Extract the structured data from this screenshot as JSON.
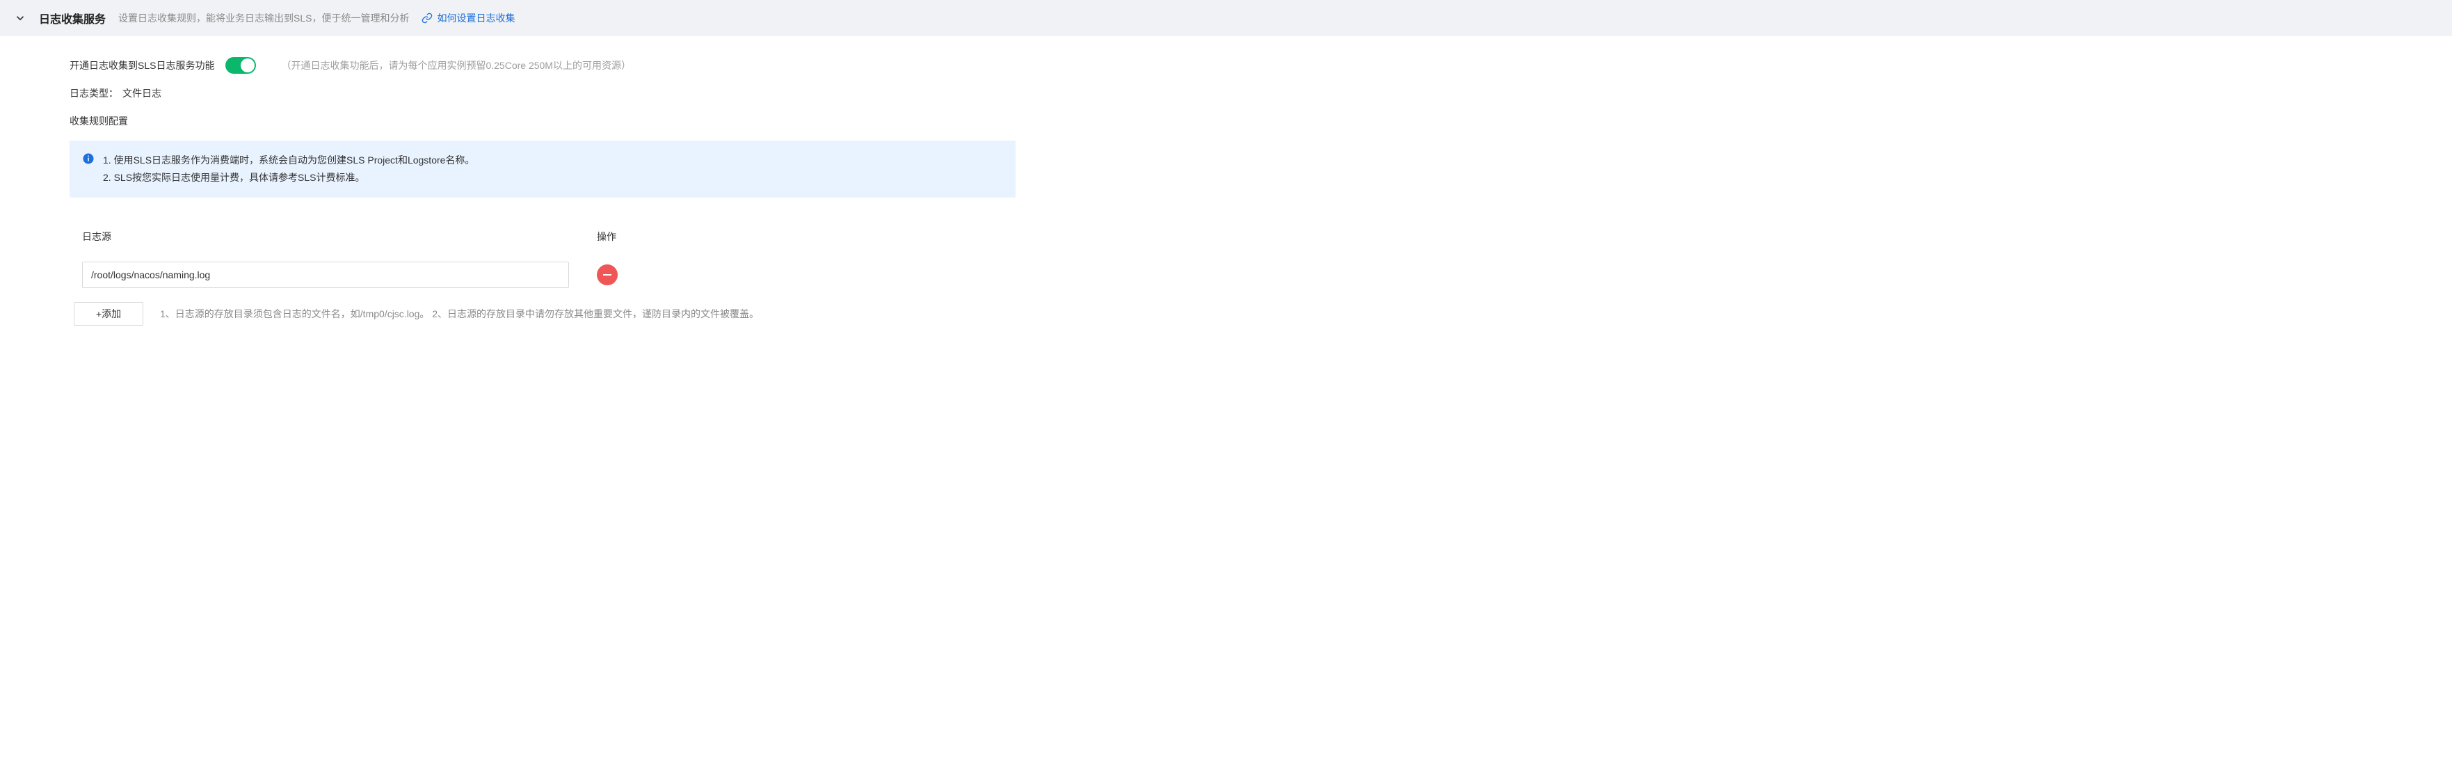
{
  "header": {
    "title": "日志收集服务",
    "desc": "设置日志收集规则，能将业务日志输出到SLS，便于统一管理和分析",
    "link_label": "如何设置日志收集"
  },
  "enable": {
    "label": "开通日志收集到SLS日志服务功能",
    "hint": "（开通日志收集功能后，请为每个应用实例预留0.25Core 250M以上的可用资源）"
  },
  "log_type": {
    "label": "日志类型：",
    "value": "文件日志"
  },
  "rule_config_label": "收集规则配置",
  "info": {
    "line1": "1. 使用SLS日志服务作为消费端时，系统会自动为您创建SLS Project和Logstore名称。",
    "line2": "2. SLS按您实际日志使用量计费，具体请参考SLS计费标准。"
  },
  "table": {
    "header_source": "日志源",
    "header_action": "操作",
    "rows": [
      {
        "source": "/root/logs/nacos/naming.log"
      }
    ]
  },
  "add_button_label": "+添加",
  "footer_hint": "1、日志源的存放目录须包含日志的文件名，如/tmp0/cjsc.log。 2、日志源的存放目录中请勿存放其他重要文件，谨防目录内的文件被覆盖。"
}
